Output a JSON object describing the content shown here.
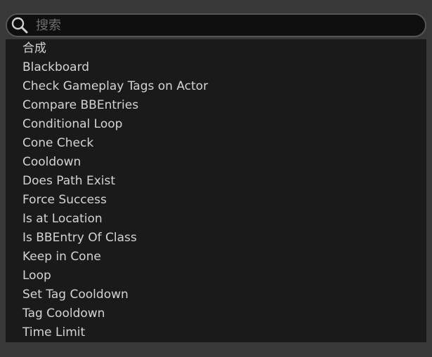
{
  "search": {
    "placeholder": "搜索",
    "value": ""
  },
  "icons": {
    "search": "search-icon"
  },
  "items": [
    {
      "label": "合成"
    },
    {
      "label": "Blackboard"
    },
    {
      "label": "Check Gameplay Tags on Actor"
    },
    {
      "label": "Compare BBEntries"
    },
    {
      "label": "Conditional Loop"
    },
    {
      "label": "Cone Check"
    },
    {
      "label": "Cooldown"
    },
    {
      "label": "Does Path Exist"
    },
    {
      "label": "Force Success"
    },
    {
      "label": "Is at Location"
    },
    {
      "label": "Is BBEntry Of Class"
    },
    {
      "label": "Keep in Cone"
    },
    {
      "label": "Loop"
    },
    {
      "label": "Set Tag Cooldown"
    },
    {
      "label": "Tag Cooldown"
    },
    {
      "label": "Time Limit"
    }
  ]
}
